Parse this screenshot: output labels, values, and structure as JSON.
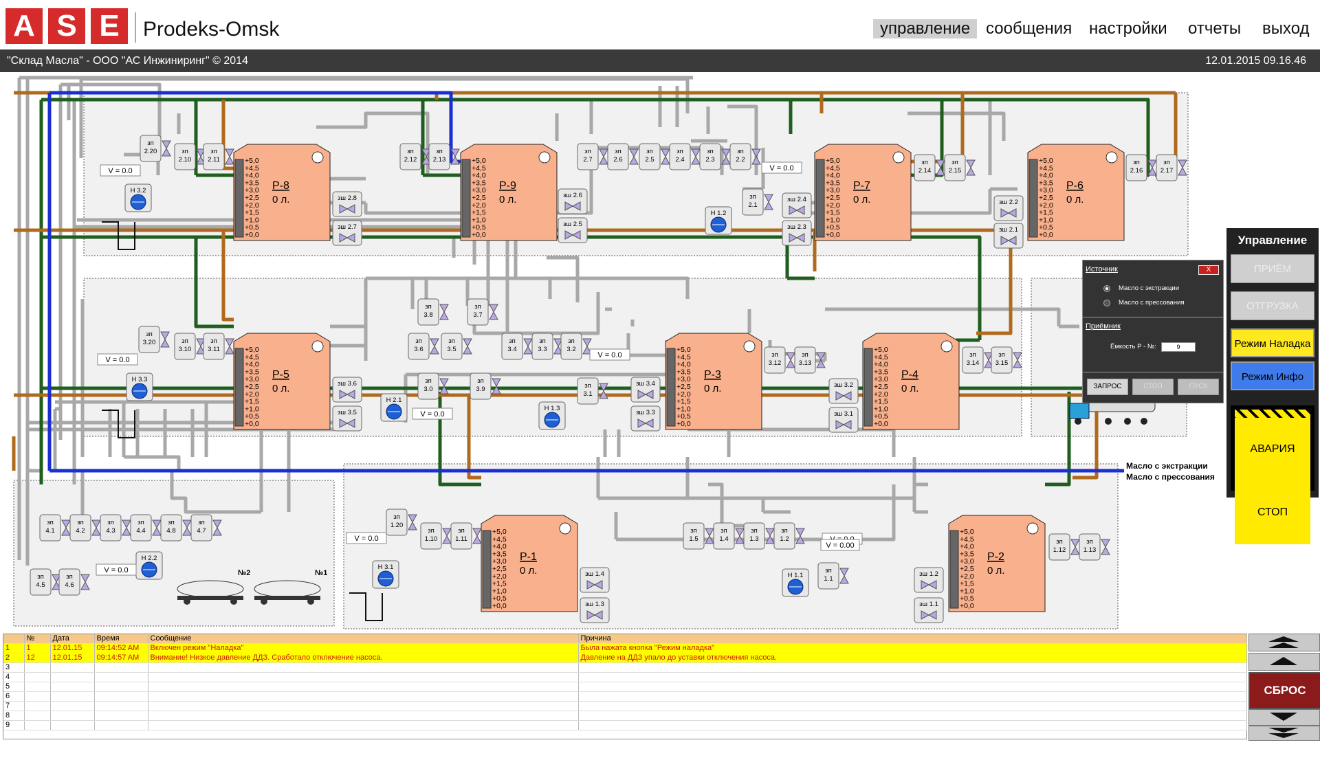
{
  "header": {
    "logo_letters": [
      "A",
      "S",
      "E"
    ],
    "company": "Prodeks-Omsk",
    "nav": [
      {
        "label": "управление",
        "active": true
      },
      {
        "label": "сообщения",
        "active": false
      },
      {
        "label": "настройки",
        "active": false
      },
      {
        "label": "отчеты",
        "active": false
      },
      {
        "label": "выход",
        "active": false
      }
    ],
    "subtitle": "\"Склад Масла\" - ООО \"АС Инжиниринг\" © 2014",
    "datetime": "12.01.2015   09.16.46"
  },
  "scheme": {
    "tanks": [
      {
        "name": "Р-8",
        "level": "0 л."
      },
      {
        "name": "Р-9",
        "level": "0 л."
      },
      {
        "name": "Р-7",
        "level": "0 л."
      },
      {
        "name": "Р-6",
        "level": "0 л."
      },
      {
        "name": "Р-5",
        "level": "0 л."
      },
      {
        "name": "Р-3",
        "level": "0 л."
      },
      {
        "name": "Р-4",
        "level": "0 л."
      },
      {
        "name": "Р-1",
        "level": "0 л."
      },
      {
        "name": "Р-2",
        "level": "0 л."
      }
    ],
    "scale_marks": [
      "+5,0",
      "+4,5",
      "+4,0",
      "+3,5",
      "+3,0",
      "+2,5",
      "+2,0",
      "+1,5",
      "+1,0",
      "+0,5",
      "+0,0"
    ],
    "valve_prefix_zp": "зп",
    "valve_prefix_zsh": "зш",
    "valves": [
      "2.20",
      "2.10",
      "2.11",
      "2.12",
      "2.13",
      "2.7",
      "2.6",
      "2.5",
      "2.4",
      "2.3",
      "2.2",
      "2.14",
      "2.15",
      "2.16",
      "2.17",
      "2.1",
      "3.20",
      "3.10",
      "3.11",
      "3.8",
      "3.7",
      "3.6",
      "3.5",
      "3.4",
      "3.3",
      "3.2",
      "3.0",
      "3.9",
      "3.1",
      "3.12",
      "3.13",
      "3.14",
      "3.15",
      "4.1",
      "4.2",
      "4.3",
      "4.4",
      "4.8",
      "4.7",
      "4.5",
      "4.6",
      "1.20",
      "1.10",
      "1.11",
      "1.5",
      "1.4",
      "1.3",
      "1.2",
      "1.1",
      "1.12",
      "1.13"
    ],
    "zsh_valves": [
      "2.8",
      "2.7",
      "2.6",
      "2.5",
      "2.4",
      "2.3",
      "2.2",
      "2.1",
      "3.6",
      "3.5",
      "3.4",
      "3.3",
      "3.2",
      "3.1",
      "1.4",
      "1.3",
      "1.2",
      "1.1"
    ],
    "pumps": [
      "Н 3.2",
      "Н 1.2",
      "Н 3.3",
      "Н 2.1",
      "Н 1.3",
      "Н 3.1",
      "Н 2.2",
      "Н 1.1"
    ],
    "flow_readouts": [
      "V =  0.0",
      "V =  0.0",
      "V =  0.0",
      "V =  0.0",
      "V =  0.0",
      "V =  0.0",
      "V =  0.0",
      "V =  0.0",
      "V =  0.00"
    ],
    "railcars": [
      "№2",
      "№1"
    ],
    "legend": [
      {
        "label": "Масло с экстракции",
        "color": "#1a2fd1"
      },
      {
        "label": "Масло с прессования",
        "color": "#1f5e1f"
      }
    ],
    "pipe_colors": {
      "grey": "#a8a8a8",
      "green": "#1f5e1f",
      "brown": "#b06a1e",
      "blue": "#1a2fd1"
    },
    "tank_color": "#f9b08c"
  },
  "dialog": {
    "source_title": "Источник",
    "close": "X",
    "source_options": [
      {
        "label": "Масло с экстракции",
        "selected": true
      },
      {
        "label": "Масло с прессования",
        "selected": false
      }
    ],
    "receiver_title": "Приёмник",
    "receiver_label": "Ёмкость Р - №:",
    "receiver_value": "9",
    "buttons": [
      "ЗАПРОС",
      "СТОП",
      "ПУСК"
    ]
  },
  "control": {
    "title": "Управление",
    "priem": "ПРИЁМ",
    "otgruzka": "ОТГРУЗКА",
    "naladka": "Режим Наладка",
    "info": "Режим Инфо",
    "stop": "АВАРИЯ СТОП"
  },
  "events": {
    "columns": [
      "№",
      "Дата",
      "Время",
      "Сообщение",
      "Причина"
    ],
    "rows": [
      {
        "n": "1",
        "id": "1",
        "date": "12.01.15",
        "time": "09:14:52 AM",
        "msg": "Включен режим \"Наладка\"",
        "cause": "Была нажата кнопка \"Режим наладка\"",
        "highlight": true
      },
      {
        "n": "2",
        "id": "12",
        "date": "12.01.15",
        "time": "09:14:57 AM",
        "msg": "Внимание! Низкое давление ДДЗ. Сработало отключение насоса.",
        "cause": "Давление на ДДЗ упало до уставки отключения насоса.",
        "highlight": true
      },
      {
        "n": "3",
        "id": "",
        "date": "",
        "time": "",
        "msg": "",
        "cause": "",
        "highlight": false
      },
      {
        "n": "4",
        "id": "",
        "date": "",
        "time": "",
        "msg": "",
        "cause": "",
        "highlight": false
      },
      {
        "n": "5",
        "id": "",
        "date": "",
        "time": "",
        "msg": "",
        "cause": "",
        "highlight": false
      },
      {
        "n": "6",
        "id": "",
        "date": "",
        "time": "",
        "msg": "",
        "cause": "",
        "highlight": false
      },
      {
        "n": "7",
        "id": "",
        "date": "",
        "time": "",
        "msg": "",
        "cause": "",
        "highlight": false
      },
      {
        "n": "8",
        "id": "",
        "date": "",
        "time": "",
        "msg": "",
        "cause": "",
        "highlight": false
      },
      {
        "n": "9",
        "id": "",
        "date": "",
        "time": "",
        "msg": "",
        "cause": "",
        "highlight": false
      }
    ],
    "reset": "СБРОС"
  }
}
